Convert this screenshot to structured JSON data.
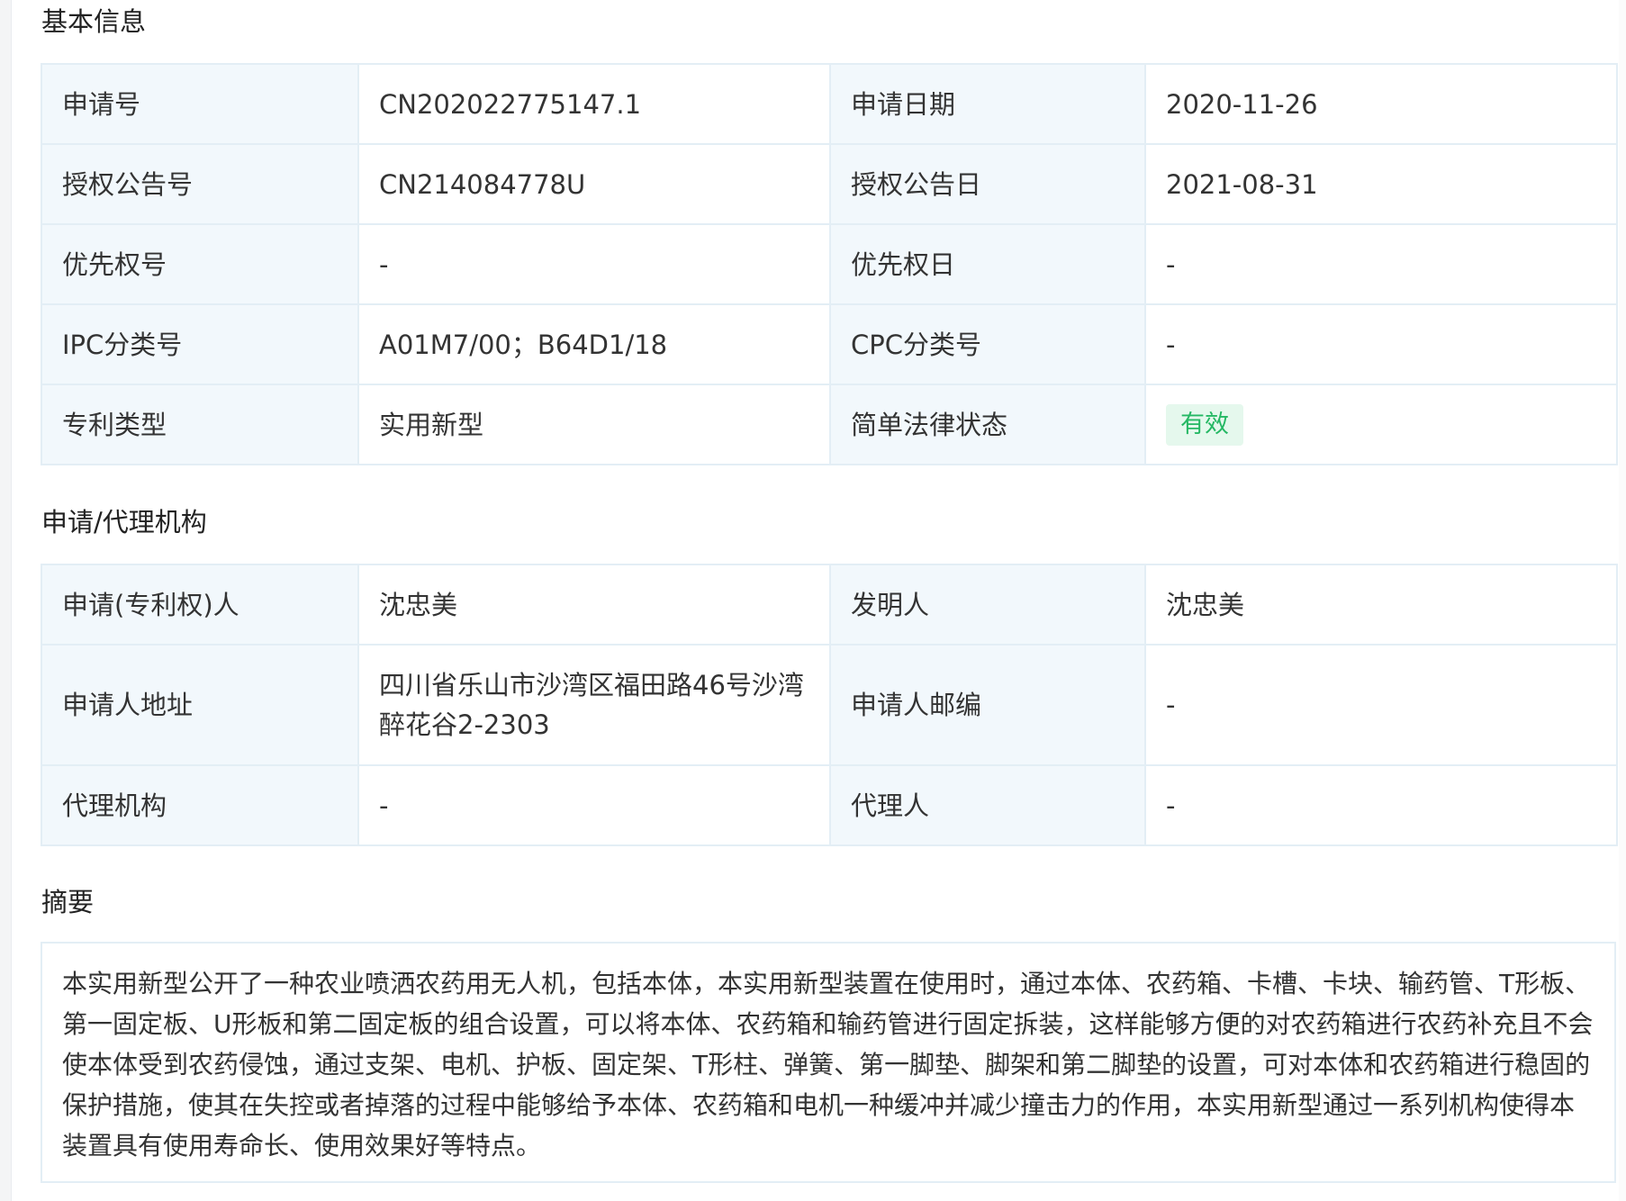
{
  "sections": {
    "basic_title": "基本信息",
    "agency_title": "申请/代理机构",
    "abstract_title": "摘要"
  },
  "basic": {
    "rows": [
      [
        {
          "label": "申请号",
          "value": "CN202022775147.1"
        },
        {
          "label": "申请日期",
          "value": "2020-11-26"
        }
      ],
      [
        {
          "label": "授权公告号",
          "value": "CN214084778U"
        },
        {
          "label": "授权公告日",
          "value": "2021-08-31"
        }
      ],
      [
        {
          "label": "优先权号",
          "value": "-"
        },
        {
          "label": "优先权日",
          "value": "-"
        }
      ],
      [
        {
          "label": "IPC分类号",
          "value": "A01M7/00；B64D1/18"
        },
        {
          "label": "CPC分类号",
          "value": "-"
        }
      ],
      [
        {
          "label": "专利类型",
          "value": "实用新型"
        },
        {
          "label": "简单法律状态",
          "value": "有效"
        }
      ]
    ]
  },
  "agency": {
    "rows": [
      [
        {
          "label": "申请(专利权)人",
          "value": "沈忠美"
        },
        {
          "label": "发明人",
          "value": "沈忠美"
        }
      ],
      [
        {
          "label": "申请人地址",
          "value": "四川省乐山市沙湾区福田路46号沙湾醉花谷2-2303"
        },
        {
          "label": "申请人邮编",
          "value": "-"
        }
      ],
      [
        {
          "label": "代理机构",
          "value": "-"
        },
        {
          "label": "代理人",
          "value": "-"
        }
      ]
    ]
  },
  "abstract": {
    "text": "本实用新型公开了一种农业喷洒农药用无人机，包括本体，本实用新型装置在使用时，通过本体、农药箱、卡槽、卡块、输药管、T形板、第一固定板、U形板和第二固定板的组合设置，可以将本体、农药箱和输药管进行固定拆装，这样能够方便的对农药箱进行农药补充且不会使本体受到农药侵蚀，通过支架、电机、护板、固定架、T形柱、弹簧、第一脚垫、脚架和第二脚垫的设置，可对本体和农药箱进行稳固的保护措施，使其在失控或者掉落的过程中能够给予本体、农药箱和电机一种缓冲并减少撞击力的作用，本实用新型通过一系列机构使得本装置具有使用寿命长、使用效果好等特点。"
  },
  "colors": {
    "label_bg": "#f2f8fc",
    "border": "#e3eef5",
    "status_badge_bg": "#e5f8ed",
    "status_badge_text": "#25b864"
  }
}
